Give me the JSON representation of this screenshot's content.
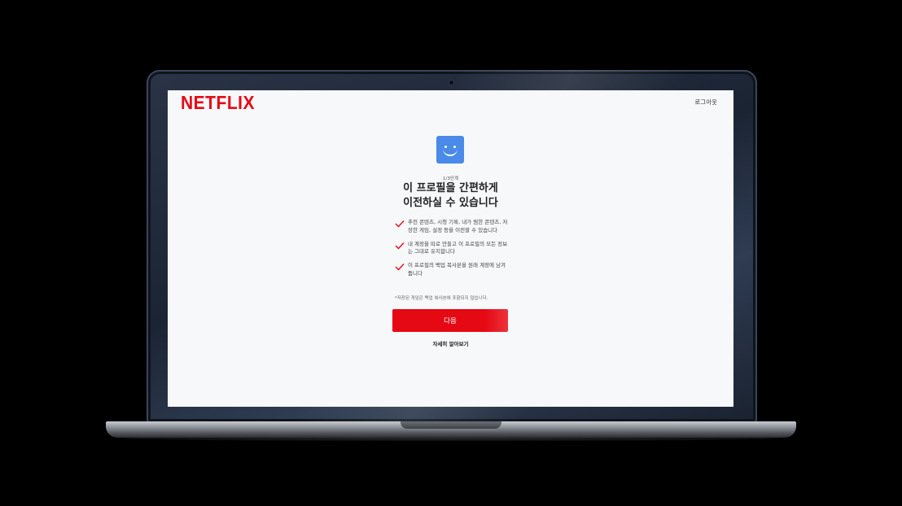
{
  "brand": {
    "logo_text": "NETFLIX",
    "logo_color": "#e50914"
  },
  "header": {
    "logout_label": "로그아웃"
  },
  "profile": {
    "avatar_color": "#4a8ae8",
    "avatar_icon": "smiley-face-icon"
  },
  "main": {
    "step_label": "1/3단계",
    "headline_line1": "이 프로필을 간편하게",
    "headline_line2": "이전하실 수 있습니다",
    "benefits": [
      {
        "icon": "check-icon",
        "text": "추천 콘텐츠, 시청 기록, 내가 찜한 콘텐츠, 저장한 게임, 설정 등을 이전할 수 있습니다"
      },
      {
        "icon": "check-icon",
        "text": "내 계정을 따로 만들고 이 프로필의 모든 정보는 그대로 유지합니다"
      },
      {
        "icon": "check-icon",
        "text": "이 프로필의 백업 복사본을 원래 계정에 남겨둡니다"
      }
    ],
    "note": "*저장된 게임은 백업 복사본에 포함되지 않습니다.",
    "next_label": "다음",
    "learn_more_label": "자세히 알아보기",
    "accent_color": "#e50914"
  }
}
